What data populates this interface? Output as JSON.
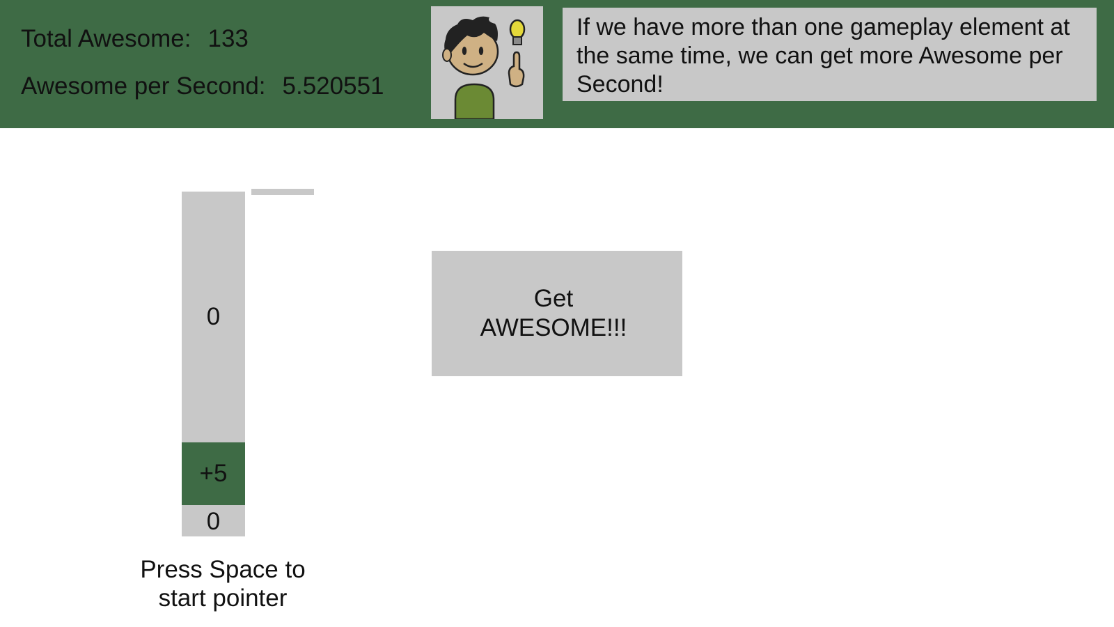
{
  "colors": {
    "header_bg": "#3e6b45",
    "panel_gray": "#c8c8c8",
    "text": "#111111",
    "page_bg": "#ffffff"
  },
  "stats": {
    "total_label": "Total Awesome:",
    "total_value": "133",
    "rate_label": "Awesome per Second:",
    "rate_value": "5.520551"
  },
  "advisor": {
    "icon": "advisor-character-with-lightbulb",
    "message": "If we have more than one gameplay element at the same time, we can get more Awesome per Second!"
  },
  "meter": {
    "top_value": "0",
    "bonus_label": "+5",
    "bottom_value": "0",
    "pointer_level": 1.0,
    "instruction": "Press Space to\nstart pointer"
  },
  "action_button": {
    "label": "Get\nAWESOME!!!"
  }
}
